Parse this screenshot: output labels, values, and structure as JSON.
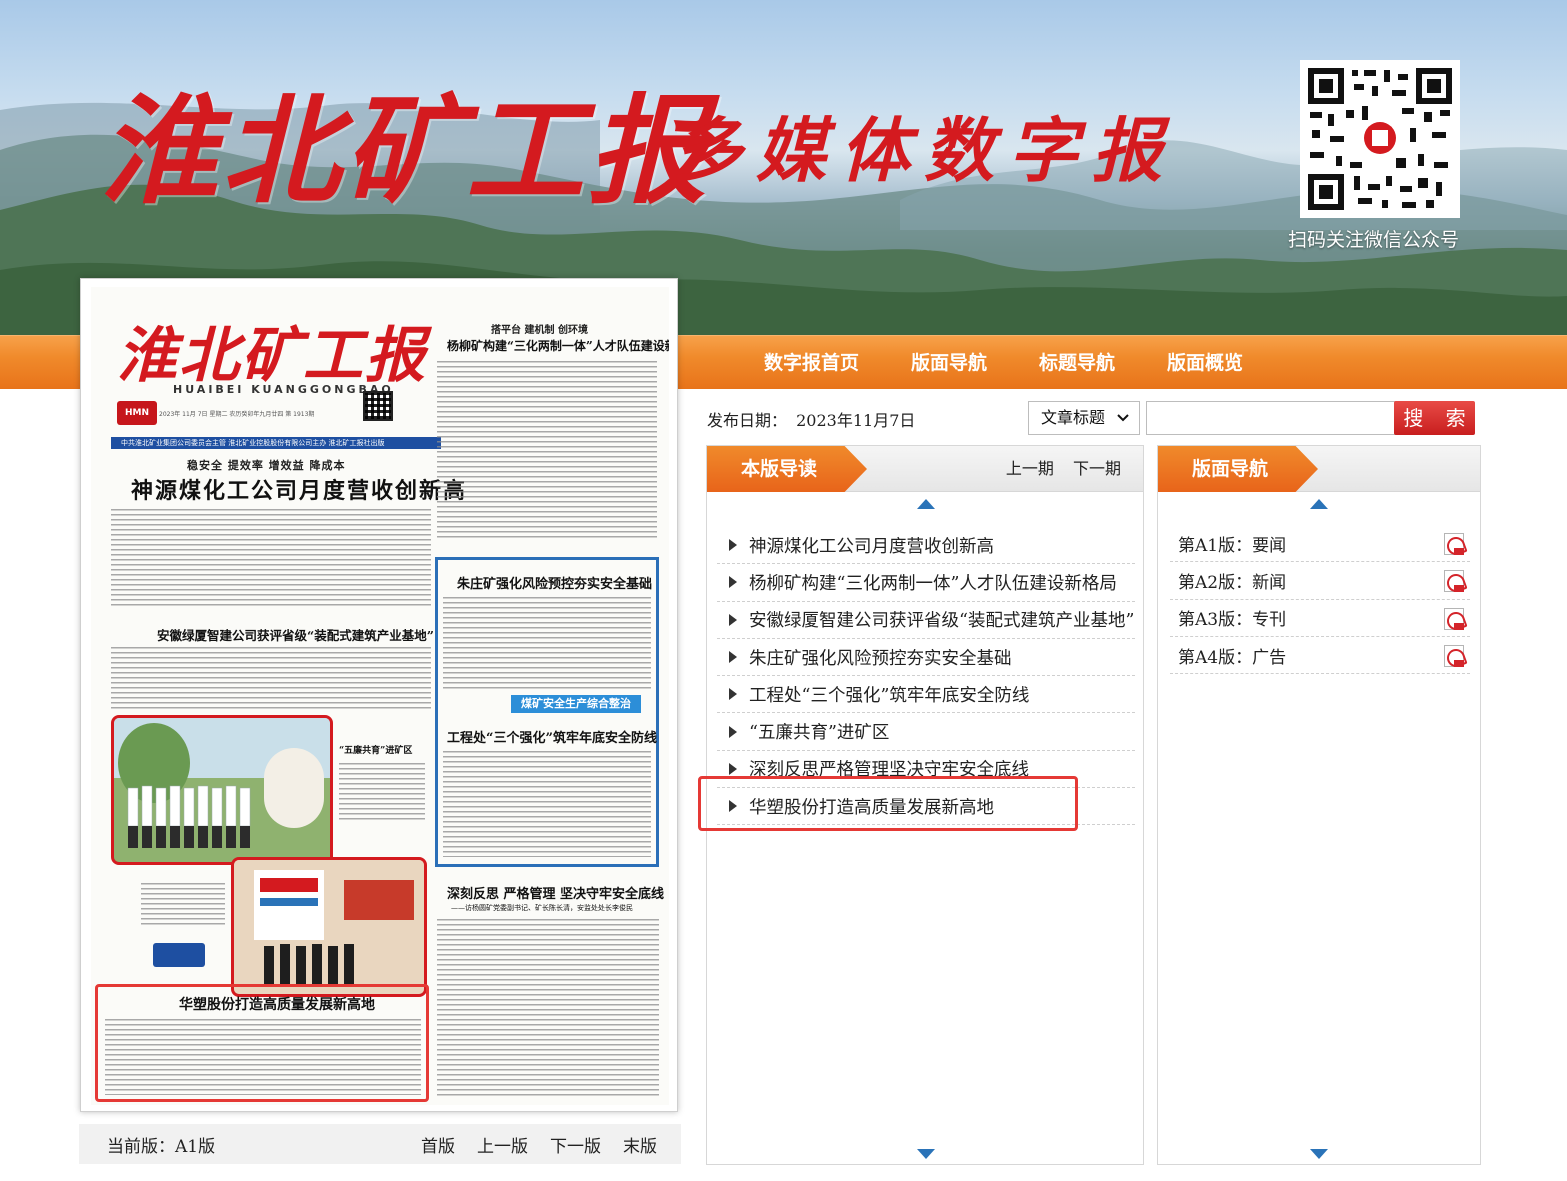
{
  "header": {
    "logo": "淮北矿工报",
    "subtitle": "多媒体数字报",
    "qr_label": "扫码关注微信公众号"
  },
  "nav": {
    "items": [
      "数字报首页",
      "版面导航",
      "标题导航",
      "版面概览"
    ]
  },
  "search": {
    "date_label": "发布日期：",
    "date_value": "2023年11月7日",
    "select_value": "文章标题",
    "input_value": "",
    "button_label": "搜 索"
  },
  "newspaper": {
    "masthead": "淮北矿工报",
    "pinyin": "HUAIBEI KUANGGONGBAO",
    "issue_line": "2023年 11月 7日 星期二 农历癸卯年九月廿四 第 1913期",
    "blue_bar": "中共淮北矿业集团公司委员会主管  淮北矿业控股股份有限公司主办  淮北矿工报社出版",
    "kicker": "稳安全 提效率 增效益 降成本",
    "headline": "神源煤化工公司月度营收创新高",
    "right_kicker": "搭平台 建机制 创环境",
    "right_headline": "杨柳矿构建“三化两制一体”人才队伍建设新格局",
    "sub_a": "安徽绿厦智建公司获评省级“装配式建筑产业基地”",
    "sub_b": "朱庄矿强化风险预控夯实安全基础",
    "blue_tag": "煤矿安全生产综合整治",
    "sub_c": "工程处“三个强化”筑牢年底安全防线",
    "sub_d": "深刻反思 严格管理 坚决守牢安全底线",
    "sub_d2": "——访杨圆矿党委副书记、矿长陈长清，安监处处长李俊民",
    "photo_caption": "“五廉共育”进矿区",
    "logo_small": "HMN",
    "bottom_headline": "华塑股份打造高质量发展新高地"
  },
  "pager": {
    "current": "当前版：A1版",
    "links": [
      "首版",
      "上一版",
      "下一版",
      "末版"
    ]
  },
  "guide_panel": {
    "title": "本版导读",
    "prev": "上一期",
    "next": "下一期",
    "items": [
      "神源煤化工公司月度营收创新高",
      "杨柳矿构建“三化两制一体”人才队伍建设新格局",
      "安徽绿厦智建公司获评省级“装配式建筑产业基地”",
      "朱庄矿强化风险预控夯实安全基础",
      "工程处“三个强化”筑牢年底安全防线",
      "“五廉共育”进矿区",
      "深刻反思严格管理坚决守牢安全底线",
      "华塑股份打造高质量发展新高地"
    ]
  },
  "page_panel": {
    "title": "版面导航",
    "items": [
      "第A1版：要闻",
      "第A2版：新闻",
      "第A3版：专刊",
      "第A4版：广告"
    ]
  },
  "colors": {
    "brand_red": "#d41a1f",
    "nav_orange": "#f08a2b",
    "highlight_red": "#e53935",
    "arrow_blue": "#2a73b8"
  }
}
